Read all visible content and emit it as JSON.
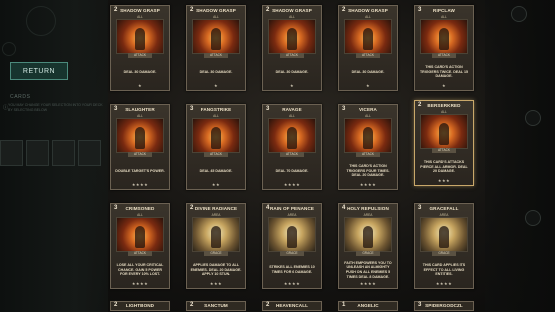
{
  "navigation": {
    "return_label": "RETURN"
  },
  "deck_panel": {
    "section_label": "CARDS",
    "note": "YOU MAY CHANGE YOUR SELECTION INTO YOUR DECK BY SELECTING BELOW"
  },
  "cards": [
    {
      "cost": "2",
      "name": "SHADOW GRASP",
      "target": "ALL",
      "type": "ATTACK",
      "desc": "DEAL 30 DAMAGE.",
      "stars": "★",
      "art": "fire"
    },
    {
      "cost": "2",
      "name": "SHADOW GRASP",
      "target": "ALL",
      "type": "ATTACK",
      "desc": "DEAL 30 DAMAGE.",
      "stars": "★",
      "art": "fire"
    },
    {
      "cost": "2",
      "name": "SHADOW GRASP",
      "target": "ALL",
      "type": "ATTACK",
      "desc": "DEAL 30 DAMAGE.",
      "stars": "★",
      "art": "fire"
    },
    {
      "cost": "2",
      "name": "SHADOW GRASP",
      "target": "ALL",
      "type": "ATTACK",
      "desc": "DEAL 30 DAMAGE.",
      "stars": "★",
      "art": "fire"
    },
    {
      "cost": "3",
      "name": "RIPCLAW",
      "target": "ALL",
      "type": "ATTACK",
      "desc": "THIS CARD'S ACTION TRIGGERS TWICE. DEAL 15 DAMAGE.",
      "stars": "★",
      "art": "fire"
    },
    {
      "cost": "3",
      "name": "SLAUGHTER",
      "target": "ALL",
      "type": "ATTACK",
      "desc": "DOUBLE TARGET'S POWER.",
      "stars": "★★★★",
      "art": "fire"
    },
    {
      "cost": "3",
      "name": "FANGSTRIKE",
      "target": "ALL",
      "type": "ATTACK",
      "desc": "DEAL 45 DAMAGE.",
      "stars": "★★",
      "art": "fire"
    },
    {
      "cost": "3",
      "name": "RAVAGE",
      "target": "ALL",
      "type": "ATTACK",
      "desc": "DEAL 70 DAMAGE.",
      "stars": "★★★★",
      "art": "fire"
    },
    {
      "cost": "3",
      "name": "VICERA",
      "target": "ALL",
      "type": "ATTACK",
      "desc": "THIS CARD'S ACTION TRIGGERS FOUR TIMES. DEAL 20 DAMAGE.",
      "stars": "★★★★",
      "art": "fire"
    },
    {
      "cost": "2",
      "name": "BERSERKRED",
      "target": "ALL",
      "type": "ATTACK",
      "desc": "THIS CARD'S ATTACKS PIERCE ALL ARMOR. DEAL 20 DAMAGE.",
      "stars": "★★★",
      "art": "fire"
    },
    {
      "cost": "3",
      "name": "CRIMSONED",
      "target": "ALL",
      "type": "ATTACK",
      "desc": "LOSE ALL YOUR CRITICAL CHANCE. GAIN 5 POWER FOR EVERY 10% LOST.",
      "stars": "★★★★",
      "art": "fire"
    },
    {
      "cost": "2",
      "name": "DIVINE RADIANCE",
      "target": "AREA",
      "type": "GRACE",
      "desc": "APPLIES DAMAGE TO ALL ENEMIES. DEAL 20 DAMAGE. APPLY 10 STUN.",
      "stars": "★★★",
      "art": "holy"
    },
    {
      "cost": "4",
      "name": "RAIN OF PENANCE",
      "target": "AREA",
      "type": "GRACE",
      "desc": "STRIKES ALL ENEMIES 10 TIMES FOR 6 DAMAGE.",
      "stars": "★★★★",
      "art": "holy"
    },
    {
      "cost": "4",
      "name": "HOLY REPULSION",
      "target": "AREA",
      "type": "GRACE",
      "desc": "FAITH EMPOWERS YOU TO UNLEASH AN ALMIGHTY PUSH ON ALL ENEMIES 5 TIMES DEAL 8 DAMAGE.",
      "stars": "★★★★",
      "art": "holy"
    },
    {
      "cost": "3",
      "name": "GRACEFALL",
      "target": "AREA",
      "type": "GRACE",
      "desc": "THIS CARD APPLIES ITS EFFECT TO ALL LIVING ENTITIES.",
      "stars": "★★★★",
      "art": "holy"
    }
  ],
  "bottom_cards": [
    {
      "cost": "2",
      "name": "LIGHTBOND"
    },
    {
      "cost": "2",
      "name": "SANCTUM"
    },
    {
      "cost": "2",
      "name": "HEAVENCALL"
    },
    {
      "cost": "1",
      "name": "ANGELIC"
    },
    {
      "cost": "3",
      "name": "SPIDERGODCZL"
    }
  ]
}
